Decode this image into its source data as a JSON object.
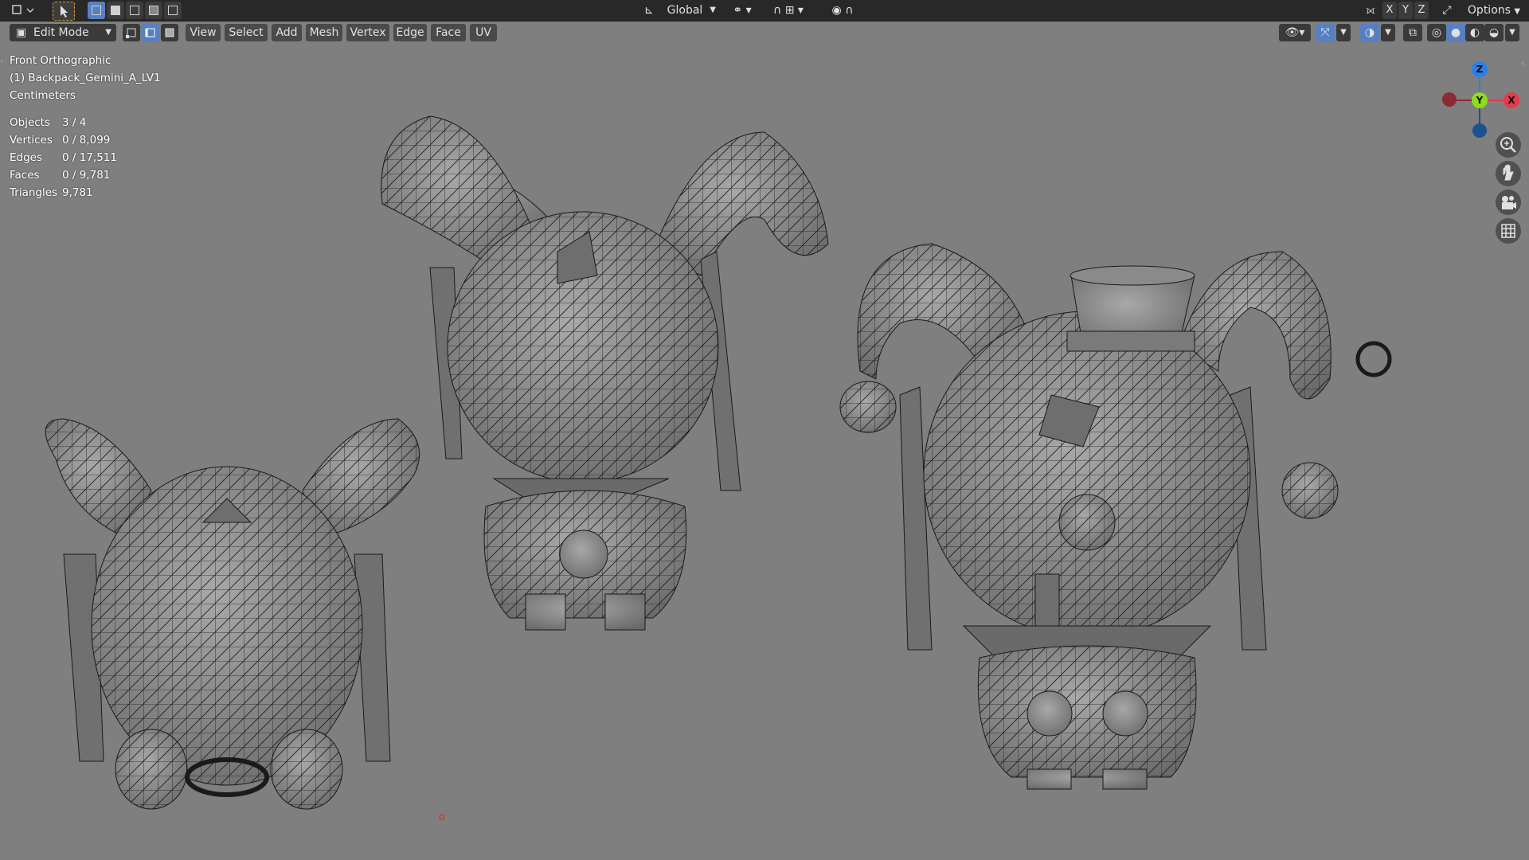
{
  "colors": {
    "viewport_bg": "#7f7f7f",
    "mesh_fill": "#8c8c8c",
    "wire": "#1a1a1a",
    "axis_x": "#e6394a",
    "axis_y": "#8bdc1e",
    "axis_z": "#2d7fe8",
    "active_blue": "#5680c2"
  },
  "topbar": {
    "orientation": "Global",
    "options_label": "Options",
    "axis_x": "X",
    "axis_y": "Y",
    "axis_z": "Z"
  },
  "header": {
    "mode": "Edit Mode",
    "menus": [
      "View",
      "Select",
      "Add",
      "Mesh",
      "Vertex",
      "Edge",
      "Face",
      "UV"
    ]
  },
  "overlay": {
    "view_name": "Front Orthographic",
    "object_name": "(1) Backpack_Gemini_A_LV1",
    "units": "Centimeters",
    "stats": [
      {
        "label": "Objects",
        "value": "3 / 4"
      },
      {
        "label": "Vertices",
        "value": "0 / 8,099"
      },
      {
        "label": "Edges",
        "value": "0 / 17,511"
      },
      {
        "label": "Faces",
        "value": "0 / 9,781"
      },
      {
        "label": "Triangles",
        "value": "9,781"
      }
    ]
  },
  "gizmo": {
    "z_label": "Z",
    "y_label": "Y",
    "x_label": "X"
  },
  "nav_icons": [
    "zoom-icon",
    "hand-pan-icon",
    "camera-icon",
    "grid-icon"
  ]
}
